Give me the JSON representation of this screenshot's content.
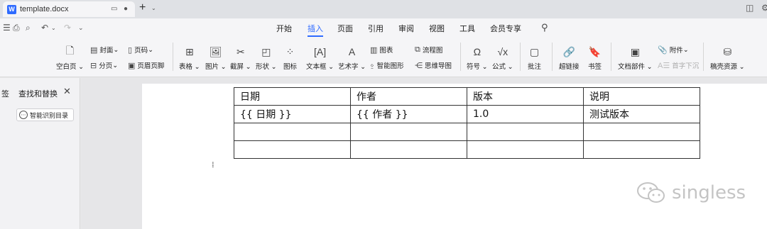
{
  "tab": {
    "title": "template.docx",
    "logo": "W"
  },
  "menu": {
    "items": [
      "开始",
      "插入",
      "页面",
      "引用",
      "审阅",
      "视图",
      "工具",
      "会员专享"
    ],
    "active_index": 1
  },
  "ribbon": {
    "blank_page": "空白页",
    "cover": "封面",
    "page_break": "分页",
    "page_number": "页码",
    "header_footer": "页眉页脚",
    "table": "表格",
    "picture": "图片",
    "screenshot": "截屏",
    "shape": "形状",
    "icon": "图标",
    "chart": "图表",
    "smart_graphic": "智能图形",
    "flowchart": "流程图",
    "mindmap": "思维导图",
    "textbox": "文本框",
    "wordart": "艺术字",
    "symbol": "符号",
    "formula": "公式",
    "comment": "批注",
    "hyperlink": "超链接",
    "bookmark": "书签",
    "doc_parts": "文档部件",
    "attachment": "附件",
    "drop_cap": "首字下沉",
    "draft_resource": "稿壳资源"
  },
  "left_panel": {
    "tab_label": "签",
    "title": "查找和替换",
    "smart_toc_button": "智能识别目录"
  },
  "doc_table": {
    "rows": [
      [
        "日期",
        "作者",
        "版本",
        "说明"
      ],
      [
        "{{ 日期 }}",
        "{{ 作者 }}",
        "1.0",
        "测试版本"
      ],
      [
        "",
        "",
        "",
        ""
      ],
      [
        "",
        "",
        "",
        ""
      ]
    ]
  },
  "watermark": {
    "text": "singless"
  }
}
